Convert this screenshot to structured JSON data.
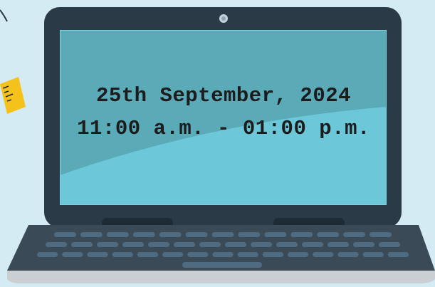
{
  "event": {
    "date": "25th September, 2024",
    "time": "11:00 a.m. - 01:00 p.m."
  },
  "colors": {
    "background": "#d5ebf3",
    "laptop_body": "#2a3a46",
    "screen_dark": "#5aaab8",
    "screen_light": "#6cc8d8",
    "base": "#3a4a56",
    "base_edge": "#c9cfd3",
    "keys": "#4f6b82",
    "ruler": "#f5c21b"
  },
  "icons": [
    "webcam-icon",
    "ruler-icon",
    "laptop-icon"
  ]
}
